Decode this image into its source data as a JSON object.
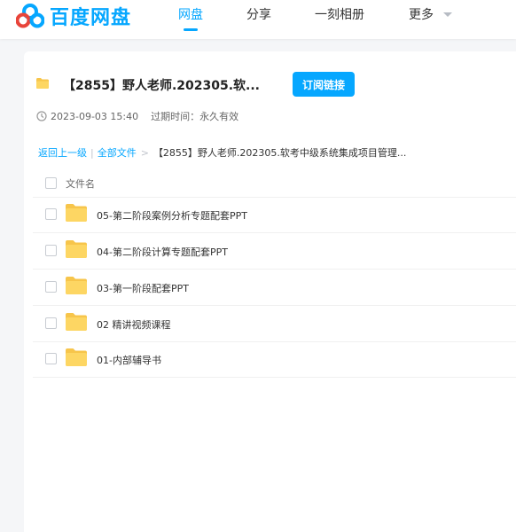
{
  "brand": {
    "name": "百度网盘",
    "accent": "#06a7ff"
  },
  "nav": {
    "items": [
      {
        "label": "网盘",
        "active": true
      },
      {
        "label": "分享",
        "active": false
      },
      {
        "label": "一刻相册",
        "active": false
      },
      {
        "label": "更多",
        "active": false
      }
    ]
  },
  "share": {
    "title": "【2855】野人老师.202305.软...",
    "subscribe_label": "订阅链接",
    "date": "2023-09-03 15:40",
    "expire_label": "过期时间：",
    "expire_value": "永久有效"
  },
  "breadcrumb": {
    "back": "返回上一级",
    "separator": "|",
    "all_files": "全部文件",
    "arrow": ">",
    "current": "【2855】野人老师.202305.软考中级系统集成项目管理..."
  },
  "file_list": {
    "header": "文件名",
    "rows": [
      {
        "name": "05-第二阶段案例分析专题配套PPT",
        "icon": "folder-icon"
      },
      {
        "name": "04-第二阶段计算专题配套PPT",
        "icon": "folder-icon"
      },
      {
        "name": "03-第一阶段配套PPT",
        "icon": "folder-icon"
      },
      {
        "name": "02 精讲视频课程",
        "icon": "folder-icon"
      },
      {
        "name": "01-内部辅导书",
        "icon": "folder-icon"
      }
    ]
  }
}
